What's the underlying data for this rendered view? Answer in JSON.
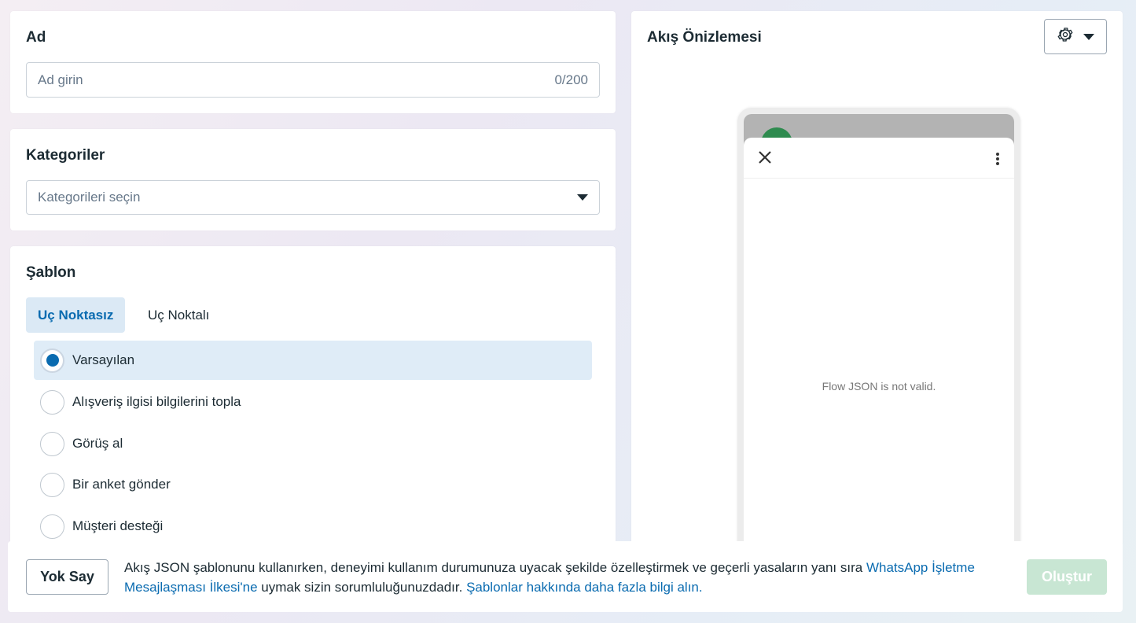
{
  "name_card": {
    "title": "Ad",
    "placeholder": "Ad girin",
    "counter": "0/200"
  },
  "categories_card": {
    "title": "Kategoriler",
    "placeholder": "Kategorileri seçin"
  },
  "template_card": {
    "title": "Şablon",
    "tabs": [
      {
        "label": "Uç Noktasız",
        "active": true
      },
      {
        "label": "Uç Noktalı",
        "active": false
      }
    ],
    "options": [
      {
        "label": "Varsayılan",
        "selected": true
      },
      {
        "label": "Alışveriş ilgisi bilgilerini topla",
        "selected": false
      },
      {
        "label": "Görüş al",
        "selected": false
      },
      {
        "label": "Bir anket gönder",
        "selected": false
      },
      {
        "label": "Müşteri desteği",
        "selected": false
      }
    ]
  },
  "preview": {
    "title": "Akış Önizlemesi",
    "message": "Flow JSON is not valid."
  },
  "footer": {
    "ignore_label": "Yok Say",
    "notice_part1": "Akış JSON şablonunu kullanırken, deneyimi kullanım durumunuza uyacak şekilde özelleştirmek ve geçerli yasaların yanı sıra ",
    "notice_link1": "WhatsApp İşletme Mesajlaşması İlkesi'ne",
    "notice_part2": " uymak sizin sorumluluğunuzdadır. ",
    "notice_link2": "Şablonlar hakkında daha fazla bilgi alın.",
    "create_label": "Oluştur"
  },
  "colors": {
    "accent": "#0a6bb0",
    "selected_bg": "#dfecf7",
    "create_disabled": "#c8e6d3",
    "avatar": "#2e8b4f"
  }
}
